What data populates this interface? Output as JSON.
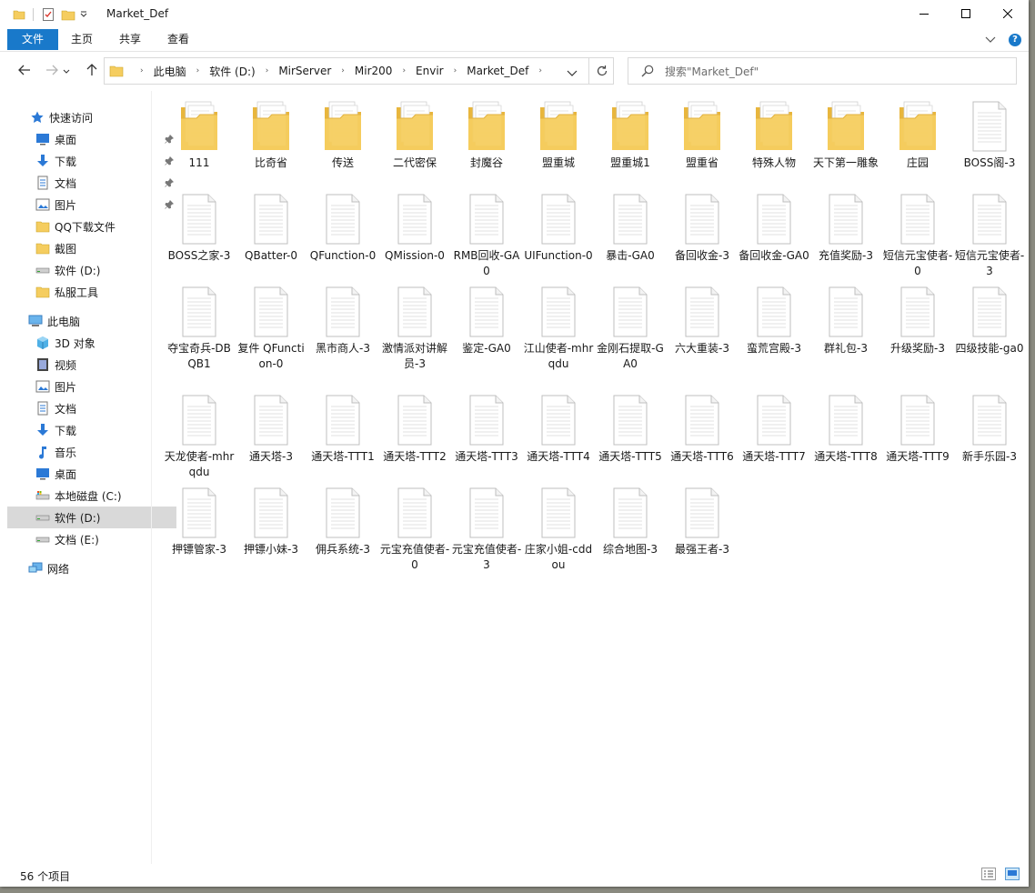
{
  "window": {
    "title": "Market_Def",
    "controls": {
      "minimize": "minimize-icon",
      "maximize": "maximize-icon",
      "close": "close-icon"
    }
  },
  "ribbon": {
    "tabs": [
      {
        "label": "文件",
        "active": true
      },
      {
        "label": "主页",
        "active": false
      },
      {
        "label": "共享",
        "active": false
      },
      {
        "label": "查看",
        "active": false
      }
    ]
  },
  "nav": {
    "breadcrumbs": [
      "此电脑",
      "软件 (D:)",
      "MirServer",
      "Mir200",
      "Envir",
      "Market_Def"
    ],
    "search_placeholder": "搜索\"Market_Def\""
  },
  "sidebar": {
    "items": [
      {
        "label": "快速访问",
        "icon": "star-icon",
        "indent": 0,
        "pinned": false
      },
      {
        "label": "桌面",
        "icon": "desktop-icon",
        "indent": 1,
        "pinned": true
      },
      {
        "label": "下载",
        "icon": "download-icon",
        "indent": 1,
        "pinned": true
      },
      {
        "label": "文档",
        "icon": "document-icon",
        "indent": 1,
        "pinned": true
      },
      {
        "label": "图片",
        "icon": "picture-icon",
        "indent": 1,
        "pinned": true
      },
      {
        "label": "QQ下载文件",
        "icon": "folder-icon",
        "indent": 1,
        "pinned": false
      },
      {
        "label": "截图",
        "icon": "folder-icon",
        "indent": 1,
        "pinned": false
      },
      {
        "label": "软件 (D:)",
        "icon": "drive-icon",
        "indent": 1,
        "pinned": false
      },
      {
        "label": "私服工具",
        "icon": "folder-icon",
        "indent": 1,
        "pinned": false
      },
      {
        "label": "此电脑",
        "icon": "computer-icon",
        "indent": 0,
        "pinned": false
      },
      {
        "label": "3D 对象",
        "icon": "cube-icon",
        "indent": 1,
        "pinned": false
      },
      {
        "label": "视频",
        "icon": "video-icon",
        "indent": 1,
        "pinned": false
      },
      {
        "label": "图片",
        "icon": "picture-icon",
        "indent": 1,
        "pinned": false
      },
      {
        "label": "文档",
        "icon": "document-icon",
        "indent": 1,
        "pinned": false
      },
      {
        "label": "下载",
        "icon": "download-icon",
        "indent": 1,
        "pinned": false
      },
      {
        "label": "音乐",
        "icon": "music-icon",
        "indent": 1,
        "pinned": false
      },
      {
        "label": "桌面",
        "icon": "desktop-icon",
        "indent": 1,
        "pinned": false
      },
      {
        "label": "本地磁盘 (C:)",
        "icon": "system-drive-icon",
        "indent": 1,
        "pinned": false
      },
      {
        "label": "软件 (D:)",
        "icon": "drive-icon",
        "indent": 1,
        "pinned": false,
        "selected": true
      },
      {
        "label": "文档 (E:)",
        "icon": "drive-icon",
        "indent": 1,
        "pinned": false
      },
      {
        "label": "网络",
        "icon": "network-icon",
        "indent": 0,
        "pinned": false
      }
    ]
  },
  "files": [
    {
      "name": "111",
      "type": "folder"
    },
    {
      "name": "比奇省",
      "type": "folder"
    },
    {
      "name": "传送",
      "type": "folder"
    },
    {
      "name": "二代密保",
      "type": "folder"
    },
    {
      "name": "封魔谷",
      "type": "folder"
    },
    {
      "name": "盟重城",
      "type": "folder"
    },
    {
      "name": "盟重城1",
      "type": "folder"
    },
    {
      "name": "盟重省",
      "type": "folder"
    },
    {
      "name": "特殊人物",
      "type": "folder"
    },
    {
      "name": "天下第一雕象",
      "type": "folder"
    },
    {
      "name": "庄园",
      "type": "folder"
    },
    {
      "name": "BOSS阁-3",
      "type": "file"
    },
    {
      "name": "BOSS之家-3",
      "type": "file"
    },
    {
      "name": "QBatter-0",
      "type": "file"
    },
    {
      "name": "QFunction-0",
      "type": "file"
    },
    {
      "name": "QMission-0",
      "type": "file"
    },
    {
      "name": "RMB回收-GA0",
      "type": "file"
    },
    {
      "name": "UIFunction-0",
      "type": "file"
    },
    {
      "name": "暴击-GA0",
      "type": "file"
    },
    {
      "name": "备回收金-3",
      "type": "file"
    },
    {
      "name": "备回收金-GA0",
      "type": "file"
    },
    {
      "name": "充值奖励-3",
      "type": "file"
    },
    {
      "name": "短信元宝使者-0",
      "type": "file"
    },
    {
      "name": "短信元宝使者-3",
      "type": "file"
    },
    {
      "name": "夺宝奇兵-DBQB1",
      "type": "file"
    },
    {
      "name": "复件 QFunction-0",
      "type": "file"
    },
    {
      "name": "黑市商人-3",
      "type": "file"
    },
    {
      "name": "激情派对讲解员-3",
      "type": "file"
    },
    {
      "name": "鉴定-GA0",
      "type": "file"
    },
    {
      "name": "江山使者-mhrqdu",
      "type": "file"
    },
    {
      "name": "金刚石提取-GA0",
      "type": "file"
    },
    {
      "name": "六大重装-3",
      "type": "file"
    },
    {
      "name": "蛮荒宫殿-3",
      "type": "file"
    },
    {
      "name": "群礼包-3",
      "type": "file"
    },
    {
      "name": "升级奖励-3",
      "type": "file"
    },
    {
      "name": "四级技能-ga0",
      "type": "file"
    },
    {
      "name": "天龙使者-mhrqdu",
      "type": "file"
    },
    {
      "name": "通天塔-3",
      "type": "file"
    },
    {
      "name": "通天塔-TTT1",
      "type": "file"
    },
    {
      "name": "通天塔-TTT2",
      "type": "file"
    },
    {
      "name": "通天塔-TTT3",
      "type": "file"
    },
    {
      "name": "通天塔-TTT4",
      "type": "file"
    },
    {
      "name": "通天塔-TTT5",
      "type": "file"
    },
    {
      "name": "通天塔-TTT6",
      "type": "file"
    },
    {
      "name": "通天塔-TTT7",
      "type": "file"
    },
    {
      "name": "通天塔-TTT8",
      "type": "file"
    },
    {
      "name": "通天塔-TTT9",
      "type": "file"
    },
    {
      "name": "新手乐园-3",
      "type": "file"
    },
    {
      "name": "押镖管家-3",
      "type": "file"
    },
    {
      "name": "押镖小妹-3",
      "type": "file"
    },
    {
      "name": "佣兵系统-3",
      "type": "file"
    },
    {
      "name": "元宝充值使者-0",
      "type": "file"
    },
    {
      "name": "元宝充值使者-3",
      "type": "file"
    },
    {
      "name": "庄家小姐-cddou",
      "type": "file"
    },
    {
      "name": "综合地图-3",
      "type": "file"
    },
    {
      "name": "最强王者-3",
      "type": "file"
    }
  ],
  "status": {
    "item_count": "56 个项目"
  },
  "colors": {
    "accent": "#1979ca",
    "folder": "#f5cd5f",
    "selected": "#d9d9d9"
  }
}
